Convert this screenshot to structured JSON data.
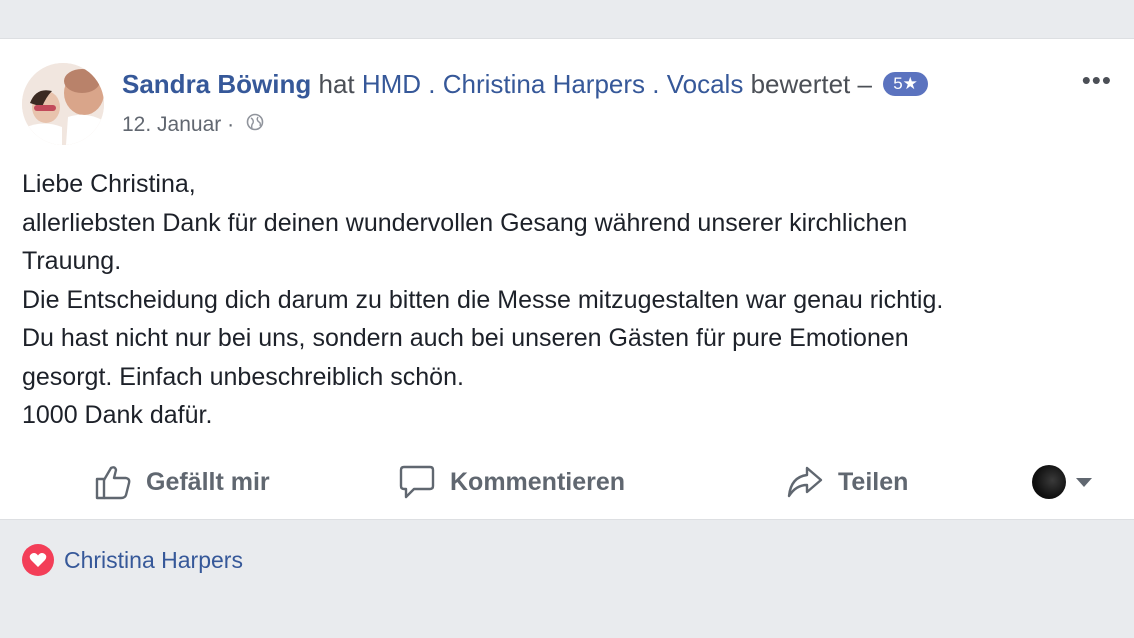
{
  "post": {
    "author": "Sandra Böwing",
    "verb_before": "hat",
    "page_name": "HMD . Christina Harpers . Vocals",
    "verb_after": "bewertet –",
    "rating_badge": "5★",
    "date": "12. Januar",
    "date_separator": "·",
    "audience_icon": "globe-icon",
    "more_label": "•••",
    "body_lines": [
      "Liebe Christina,",
      "allerliebsten Dank für deinen wundervollen Gesang während unserer kirchlichen",
      "Trauung.",
      "Die Entscheidung dich darum zu bitten die Messe mitzugestalten war genau richtig.",
      "Du hast nicht nur bei uns, sondern auch bei unseren Gästen für pure Emotionen",
      "gesorgt. Einfach unbeschreiblich schön.",
      "1000 Dank dafür."
    ]
  },
  "actions": {
    "like_label": "Gefällt mir",
    "comment_label": "Kommentieren",
    "share_label": "Teilen"
  },
  "reactions": {
    "icon": "heart-icon",
    "names": "Christina Harpers"
  },
  "colors": {
    "link": "#365899",
    "badge": "#5b73bf",
    "heart": "#f33e58",
    "action_text": "#606770",
    "background": "#e9ebee"
  }
}
